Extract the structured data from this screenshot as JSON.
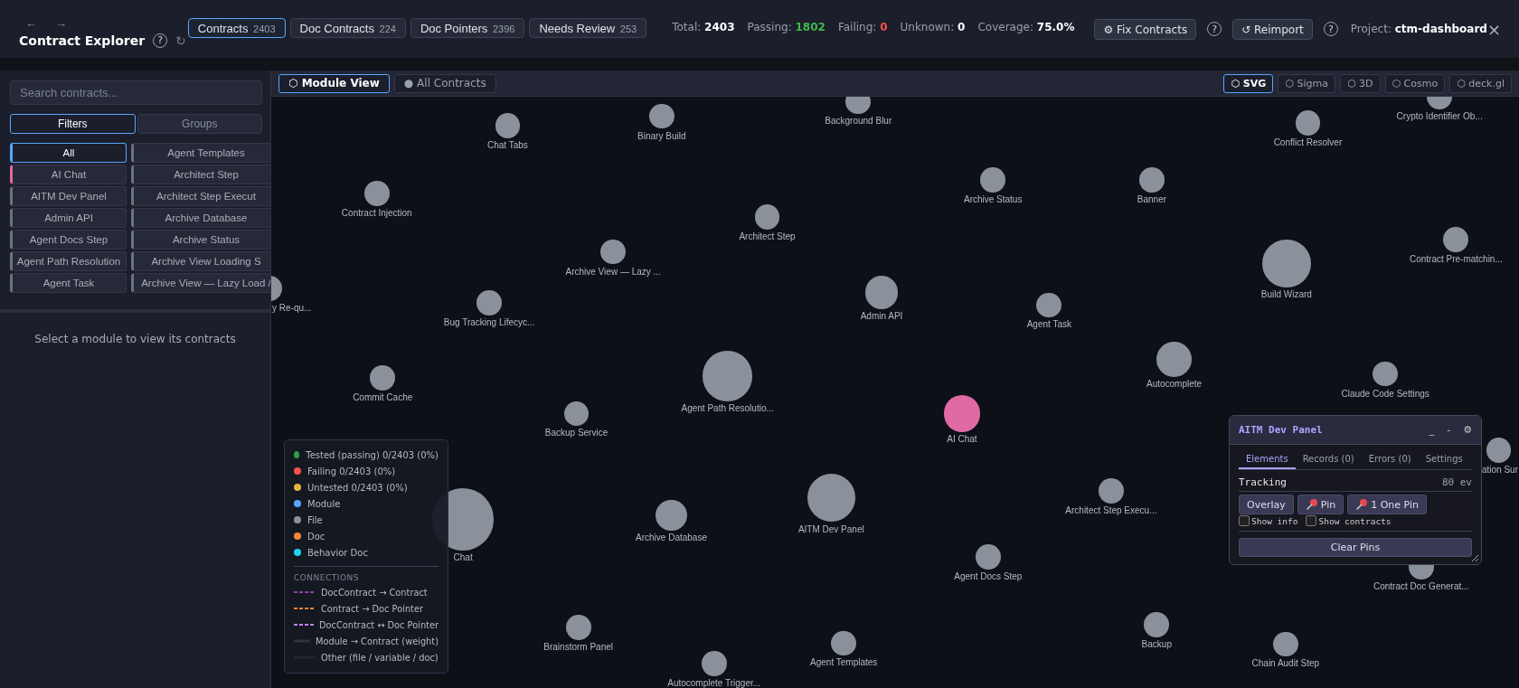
{
  "header": {
    "nav": [
      "←",
      "→"
    ],
    "title": "Contract Explorer",
    "title_help": "?",
    "refresh": "↻",
    "tabs": [
      {
        "label": "Contracts",
        "count": "2403",
        "selected": true
      },
      {
        "label": "Doc Contracts",
        "count": "224",
        "selected": false
      },
      {
        "label": "Doc Pointers",
        "count": "2396",
        "selected": false
      },
      {
        "label": "Needs Review",
        "count": "253",
        "selected": false
      }
    ],
    "stats": [
      {
        "label": "Total:",
        "value": "2403",
        "color": "#ffffff"
      },
      {
        "label": "Passing:",
        "value": "1802",
        "color": "#3fb950"
      },
      {
        "label": "Failing:",
        "value": "0",
        "color": "#f85149"
      },
      {
        "label": "Unknown:",
        "value": "0",
        "color": "#ffffff"
      },
      {
        "label": "Coverage:",
        "value": "75.0%",
        "color": "#ffffff"
      }
    ],
    "actions": [
      {
        "kind": "button",
        "label": "⚙ Fix Contracts"
      },
      {
        "kind": "help",
        "label": "?"
      },
      {
        "kind": "button",
        "label": "↺ Reimport"
      },
      {
        "kind": "help",
        "label": "?"
      }
    ],
    "project_label": "Project:",
    "project": "ctm-dashboard",
    "close": "×"
  },
  "sidebar": {
    "search": {
      "placeholder": "Search contracts..."
    },
    "tabs": [
      {
        "label": "Filters",
        "selected": true
      },
      {
        "label": "Groups",
        "selected": false
      }
    ],
    "modules": [
      {
        "label": "All",
        "color": "#58a6ff",
        "selected": true
      },
      {
        "label": "AI Chat",
        "color": "#e06aa3",
        "selected": false
      },
      {
        "label": "AITM Dev Panel",
        "color": "#6b7280",
        "selected": false
      },
      {
        "label": "Admin API",
        "color": "#6b7280",
        "selected": false
      },
      {
        "label": "Agent Docs Step",
        "color": "#6b7280",
        "selected": false
      },
      {
        "label": "Agent Path Resolution",
        "color": "#6b7280",
        "selected": false
      },
      {
        "label": "Agent Task",
        "color": "#6b7280",
        "selected": false
      },
      {
        "label": "Agent Templates",
        "color": "#6b7280",
        "selected": false
      },
      {
        "label": "Architect Step",
        "color": "#6b7280",
        "selected": false
      },
      {
        "label": "Architect Step Execut",
        "color": "#6b7280",
        "selected": false
      },
      {
        "label": "Archive Database",
        "color": "#6b7280",
        "selected": false
      },
      {
        "label": "Archive Status",
        "color": "#6b7280",
        "selected": false
      },
      {
        "label": "Archive View Loading S",
        "color": "#6b7280",
        "selected": false
      },
      {
        "label": "Archive View — Lazy Load /",
        "color": "#6b7280",
        "selected": false
      }
    ],
    "message": "Select a module to view its contracts"
  },
  "canvas": {
    "views": [
      {
        "label": "⬡ Module View",
        "selected": true
      },
      {
        "label": "● All Contracts",
        "selected": false
      }
    ],
    "renderers": [
      {
        "label": "⬡ SVG",
        "selected": true
      },
      {
        "label": "⬡ Sigma",
        "selected": false
      },
      {
        "label": "⬡ 3D",
        "selected": false
      },
      {
        "label": "⬡ Cosmo",
        "selected": false
      },
      {
        "label": "⬡ deck.gl",
        "selected": false
      }
    ],
    "nodes": [
      {
        "label": "Background Blur",
        "color": "#8b919b"
      },
      {
        "label": "Crypto Identifier Ob...",
        "color": "#8b919b"
      },
      {
        "label": "Binary Build",
        "color": "#8b919b"
      },
      {
        "label": "Chat Tabs",
        "color": "#8b919b"
      },
      {
        "label": "Conflict Resolver",
        "color": "#8b919b"
      },
      {
        "label": "Archive Status",
        "color": "#8b919b"
      },
      {
        "label": "Banner",
        "color": "#8b919b"
      },
      {
        "label": "Contract Injection",
        "color": "#8b919b"
      },
      {
        "label": "Architect Step",
        "color": "#8b919b"
      },
      {
        "label": "Contract Pre-matchin...",
        "color": "#8b919b"
      },
      {
        "label": "Archive View — Lazy ...",
        "color": "#8b919b"
      },
      {
        "label": "Build Wizard",
        "color": "#8b919b"
      },
      {
        "label": "y Re-qu...",
        "color": "#8b919b"
      },
      {
        "label": "Admin API",
        "color": "#8b919b"
      },
      {
        "label": "Bug Tracking Lifecyc...",
        "color": "#8b919b"
      },
      {
        "label": "Agent Task",
        "color": "#8b919b"
      },
      {
        "label": "Autocomplete",
        "color": "#8b919b"
      },
      {
        "label": "Agent Path Resolutio...",
        "color": "#8b919b"
      },
      {
        "label": "Commit Cache",
        "color": "#8b919b"
      },
      {
        "label": "Claude Code Settings",
        "color": "#8b919b"
      },
      {
        "label": "Backup Service",
        "color": "#8b919b"
      },
      {
        "label": "AI Chat",
        "color": "#e06aa3"
      },
      {
        "label": "ation Sur",
        "color": "#8b919b"
      },
      {
        "label": "Architect Step Execu...",
        "color": "#8b919b"
      },
      {
        "label": "AITM Dev Panel",
        "color": "#8b919b"
      },
      {
        "label": "Archive Database",
        "color": "#8b919b"
      },
      {
        "label": "Chat",
        "color": "#8b919b"
      },
      {
        "label": "Agent Docs Step",
        "color": "#8b919b"
      },
      {
        "label": "Contract Doc Generat...",
        "color": "#8b919b"
      },
      {
        "label": "Backup",
        "color": "#8b919b"
      },
      {
        "label": "Brainstorm Panel",
        "color": "#8b919b"
      },
      {
        "label": "Agent Templates",
        "color": "#8b919b"
      },
      {
        "label": "Chain Audit Step",
        "color": "#8b919b"
      },
      {
        "label": "Autocomplete Trigger...",
        "color": "#8b919b"
      }
    ],
    "legend": {
      "items": [
        {
          "label": "Tested (passing) 0/2403 (0%)",
          "color": "#2ea043"
        },
        {
          "label": "Failing 0/2403 (0%)",
          "color": "#f85149"
        },
        {
          "label": "Untested 0/2403 (0%)",
          "color": "#e3b341"
        },
        {
          "label": "Module",
          "color": "#58a6ff"
        },
        {
          "label": "File",
          "color": "#8b919b"
        },
        {
          "label": "Doc",
          "color": "#f0883e"
        },
        {
          "label": "Behavior Doc",
          "color": "#22d3ee"
        }
      ],
      "connections_title": "CONNECTIONS",
      "connections": [
        {
          "label": "DocContract → Contract",
          "kind": "dashed",
          "color": "#8e44ad"
        },
        {
          "label": "Contract → Doc Pointer",
          "kind": "dashed",
          "color": "#f0883e"
        },
        {
          "label": "DocContract ↔ Doc Pointer",
          "kind": "dashed",
          "color": "#c084fc"
        },
        {
          "label": "Module → Contract (weight)",
          "kind": "solid",
          "color": "#2d333b"
        },
        {
          "label": "Other (file / variable / doc)",
          "kind": "solid",
          "color": "#20252c"
        }
      ]
    }
  },
  "dev_panel": {
    "title": "AITM Dev Panel",
    "controls": [
      "_",
      "-",
      "⚙"
    ],
    "tabs": [
      {
        "label": "Elements",
        "selected": true
      },
      {
        "label": "Records (0)",
        "selected": false
      },
      {
        "label": "Errors (0)",
        "selected": false
      },
      {
        "label": "Settings",
        "selected": false
      }
    ],
    "tracking_label": "Tracking",
    "tracking_value": "80 ev",
    "buttons": [
      {
        "label": "Overlay",
        "kind": "plain"
      },
      {
        "label": "Pin",
        "kind": "pin"
      },
      {
        "label": "1 One Pin",
        "kind": "pin"
      }
    ],
    "checkboxes": [
      {
        "label": "Show info",
        "checked": false
      },
      {
        "label": "Show contracts",
        "checked": false
      }
    ],
    "clear": "Clear Pins"
  }
}
